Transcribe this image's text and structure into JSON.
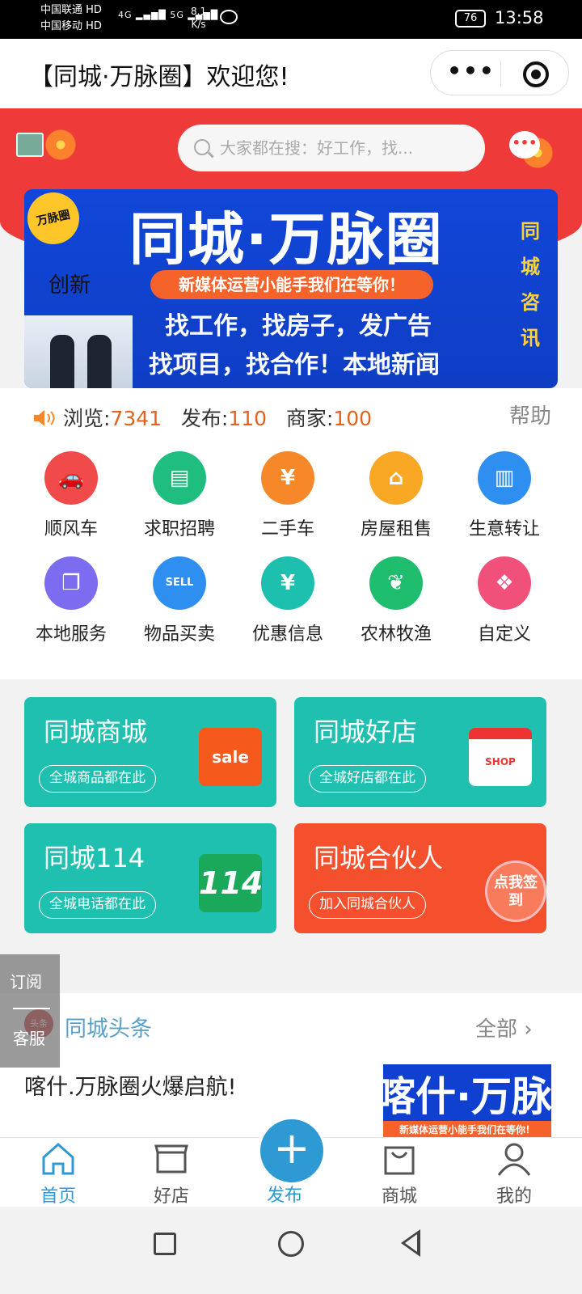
{
  "status_bar": {
    "carrier1": "中国联通",
    "carrier2": "中国移动",
    "hd": "HD",
    "signal1": "4G",
    "signal2": "5G",
    "speed_value": "8.1",
    "speed_unit": "K/s",
    "battery": "76",
    "time": "13:58"
  },
  "title_bar": {
    "title": "【同城·万脉圈】欢迎您!",
    "more_label": "•••"
  },
  "hero": {
    "search_placeholder": "大家都在搜：好工作，找...",
    "message_icon": "message-icon"
  },
  "banner": {
    "title": "同城·万脉圈",
    "seal": "万脉圈",
    "tag": "创新",
    "pill": "新媒体运营小能手我们在等你！",
    "line1": "找工作，找房子，发广告",
    "line2": "找项目，找合作！本地新闻",
    "side": [
      "同",
      "城",
      "咨",
      "讯"
    ]
  },
  "stats": {
    "browse_label": "浏览:",
    "browse_value": "7341",
    "publish_label": "发布:",
    "publish_value": "110",
    "merchant_label": "商家:",
    "merchant_value": "100",
    "help": "帮助"
  },
  "categories": [
    {
      "label": "顺风车",
      "icon": "car-icon",
      "color": "#f04a4a",
      "glyph": "🚗"
    },
    {
      "label": "求职招聘",
      "icon": "id-card-icon",
      "color": "#1fbd7e",
      "glyph": "▤"
    },
    {
      "label": "二手车",
      "icon": "used-car-icon",
      "color": "#f7882a",
      "glyph": "¥"
    },
    {
      "label": "房屋租售",
      "icon": "house-icon",
      "color": "#f9a826",
      "glyph": "⌂"
    },
    {
      "label": "生意转让",
      "icon": "shop-icon",
      "color": "#2f8ff0",
      "glyph": "▥"
    },
    {
      "label": "本地服务",
      "icon": "pages-icon",
      "color": "#7b6cf0",
      "glyph": "❐"
    },
    {
      "label": "物品买卖",
      "icon": "sell-tag-icon",
      "color": "#2f8ff0",
      "glyph": "SELL"
    },
    {
      "label": "优惠信息",
      "icon": "ticket-icon",
      "color": "#1dbfae",
      "glyph": "¥"
    },
    {
      "label": "农林牧渔",
      "icon": "sprout-icon",
      "color": "#1fbd6e",
      "glyph": "❦"
    },
    {
      "label": "自定义",
      "icon": "grid-icon",
      "color": "#f0507a",
      "glyph": "❖"
    }
  ],
  "cards": [
    {
      "title": "同城商城",
      "sub": "全城商品都在此",
      "color": "#1fc0b0",
      "icon": "sale-bag-icon",
      "icon_text": "sale"
    },
    {
      "title": "同城好店",
      "sub": "全城好店都在此",
      "color": "#1fc0b0",
      "icon": "storefront-icon",
      "icon_text": "SHOP"
    },
    {
      "title": "同城114",
      "sub": "全城电话都在此",
      "color": "#1fc0b0",
      "icon": "phone-114-icon",
      "icon_text": "114"
    },
    {
      "title": "同城合伙人",
      "sub": "加入同城合伙人",
      "color": "#f5502e",
      "icon": "handshake-icon",
      "icon_text": "点我签到"
    }
  ],
  "floating": {
    "subscribe": "订阅",
    "service": "客服"
  },
  "headline": {
    "badge": "头条",
    "title": "同城头条",
    "all": "全部",
    "item": "喀什.万脉圈火爆启航!",
    "thumb_title": "喀什·万脉",
    "thumb_sub": "新媒体运营小能手我们在等你！"
  },
  "tabbar": {
    "home": "首页",
    "shops": "好店",
    "publish": "发布",
    "mall": "商城",
    "mine": "我的",
    "active_color": "#2d9ad3"
  }
}
